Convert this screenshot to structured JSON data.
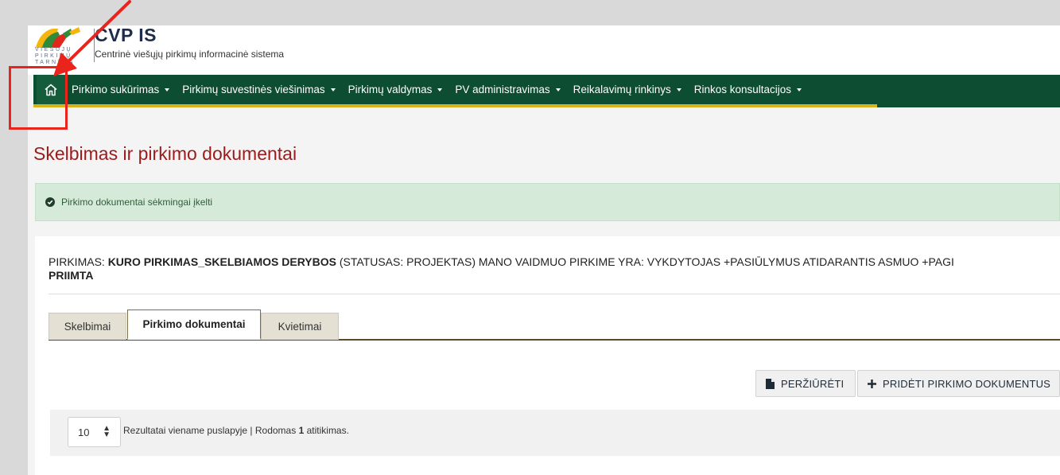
{
  "header": {
    "logo_small_text": "VIEŠUJŲ PIRKIMŲ TARNYBA",
    "title": "CVP IS",
    "subtitle": "Centrinė viešųjų pirkimų informacinė sistema"
  },
  "nav": {
    "home_icon": "home-icon",
    "items": [
      {
        "label": "Pirkimo sukūrimas"
      },
      {
        "label": "Pirkimų suvestinės viešinimas"
      },
      {
        "label": "Pirkimų valdymas"
      },
      {
        "label": "PV administravimas"
      },
      {
        "label": "Reikalavimų rinkinys"
      },
      {
        "label": "Rinkos konsultacijos"
      }
    ]
  },
  "page": {
    "title": "Skelbimas ir pirkimo dokumentai"
  },
  "alert": {
    "icon": "check-circle-icon",
    "text": "Pirkimo dokumentai sėkmingai įkelti"
  },
  "procurement": {
    "label": "PIRKIMAS:",
    "name": "KURO PIRKIMAS_SKELBIAMOS DERYBOS",
    "status": "(STATUSAS: PROJEKTAS) MANO VAIDMUO PIRKIME YRA: VYKDYTOJAS +PASIŪLYMUS ATIDARANTIS ASMUO +PAGI",
    "status_cont": "PRIIMTA"
  },
  "tabs": [
    {
      "label": "Skelbimai",
      "active": false
    },
    {
      "label": "Pirkimo dokumentai",
      "active": true
    },
    {
      "label": "Kvietimai",
      "active": false
    }
  ],
  "actions": {
    "preview_label": "PERŽIŪRĖTI",
    "add_label": "PRIDĖTI PIRKIMO DOKUMENTUS"
  },
  "results": {
    "per_page": "10",
    "text_before": "Rezultatai viename puslapyje | Rodomas ",
    "count": "1",
    "text_after": " atitikimas."
  },
  "colors": {
    "nav_bg": "#0d4d31",
    "nav_accent": "#d8b21c",
    "title_red": "#9b1b1b",
    "alert_bg": "#d6ead9",
    "annotation_red": "#e8241c"
  }
}
